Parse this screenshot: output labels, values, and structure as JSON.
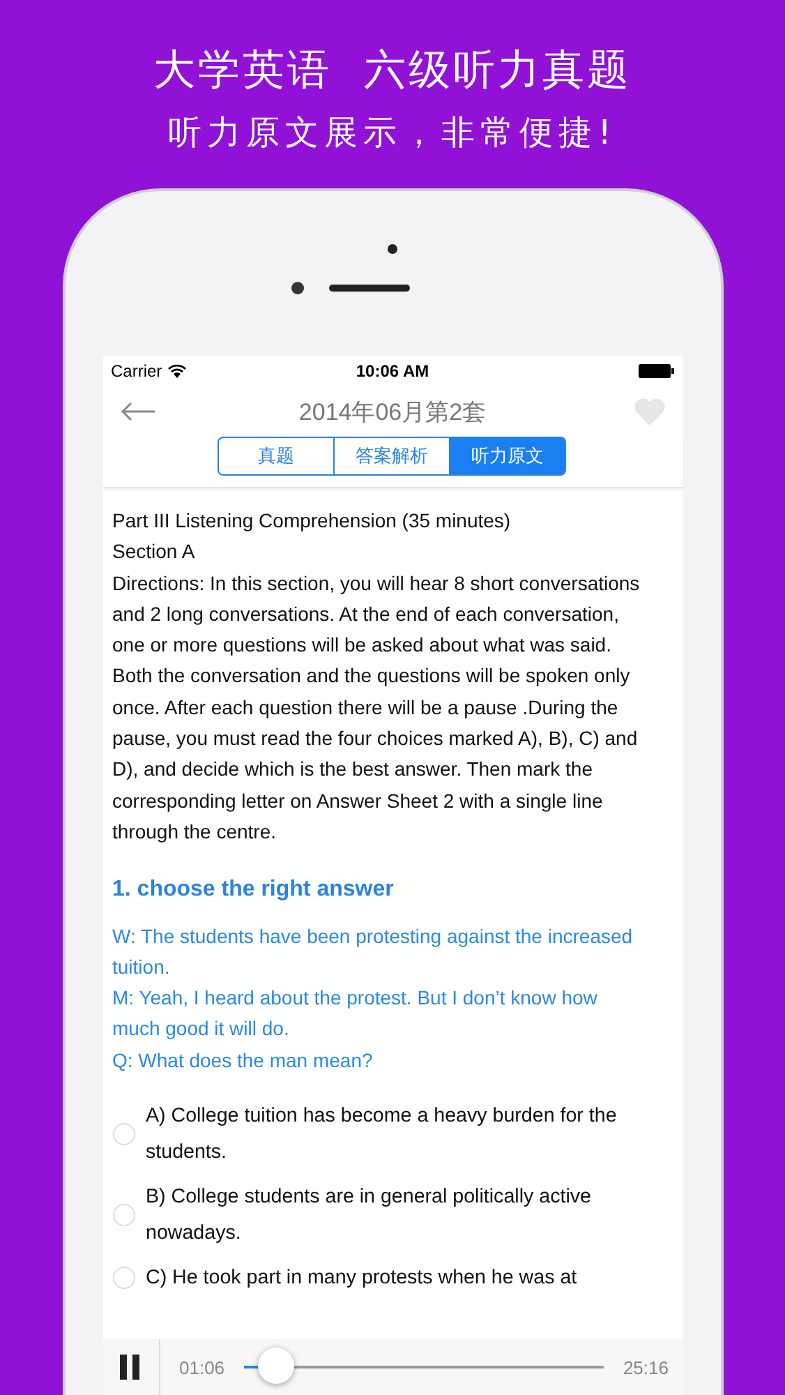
{
  "banner": {
    "title": "大学英语  六级听力真题",
    "subtitle": "听力原文展示，非常便捷!"
  },
  "status_bar": {
    "carrier": "Carrier",
    "time": "10:06 AM"
  },
  "nav": {
    "title": "2014年06月第2套",
    "favorite": false
  },
  "tabs": [
    {
      "label": "真题",
      "selected": false
    },
    {
      "label": "答案解析",
      "selected": false
    },
    {
      "label": "听力原文",
      "selected": true
    }
  ],
  "intro": [
    "Part III Listening Comprehension (35 minutes)",
    "Section A",
    "Directions: In this section, you will hear 8 short conversations and 2 long conversations. At the end of each conversation, one or more questions will be asked about what was said. Both the conversation and the questions will be spoken only once. After each question there will be a pause .During the pause, you must read the four choices marked A), B), C) and D), and decide which is the best answer. Then mark the corresponding letter on Answer Sheet 2 with a single line through the centre."
  ],
  "question": {
    "title": "1. choose the right answer",
    "transcript": [
      "W: The students have been protesting against the increased tuition.",
      "M: Yeah, I heard about the protest. But I don’t know how much good it will do.",
      "Q: What does the man mean?"
    ],
    "options": [
      {
        "text": "A) College tuition has become a heavy burden for the students.",
        "selected": false
      },
      {
        "text": "B) College students are in general politically active nowadays.",
        "selected": false
      },
      {
        "text": "C) He took part in many protests when he was at",
        "selected": false
      }
    ]
  },
  "player": {
    "playing": true,
    "elapsed": "01:06",
    "total": "25:16",
    "level": 0.09
  }
}
